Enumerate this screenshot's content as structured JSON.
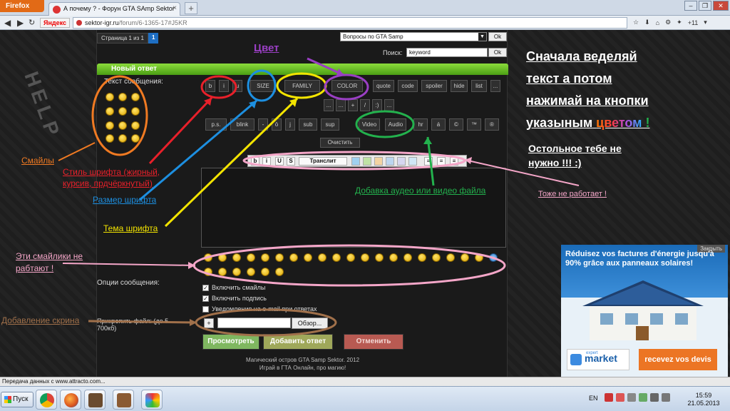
{
  "browser": {
    "app_button": "Firefox",
    "tab_title": "А почему ? - Форун GTA SAmp Sektor",
    "tab_close": "×",
    "new_tab": "+",
    "search_engine": "Яндекс",
    "url_domain": "sektor-igr.ru",
    "url_path": "/forum/6-1365-17#J5KR",
    "addon_count": "+11"
  },
  "forum": {
    "pager_label": "Страница 1 из 1",
    "pager_current": "1",
    "jump_select": "Вопросы по GTA Samp",
    "ok": "Ok",
    "search_label": "Поиск:",
    "search_value": "keyword",
    "panel_title": "Новый ответ",
    "message_label": "Текст сообщения:",
    "toolbar_row1": [
      "b",
      "i",
      "u",
      "SIZE",
      "FAMILY",
      "COLOR",
      "quote",
      "code",
      "spoiler",
      "hide",
      "list",
      "..."
    ],
    "toolbar_row2": [
      "...",
      "...",
      "+",
      "/",
      ":)",
      "..."
    ],
    "toolbar_row3": [
      "p.s.",
      "blink",
      "-",
      "ō",
      "j",
      "sub",
      "sup",
      "Video",
      "Audio",
      "hr",
      "á",
      "©",
      "™",
      "®"
    ],
    "clear_label": "Очистить",
    "editor2": [
      "b",
      "i",
      "U",
      "S",
      "Транслит"
    ],
    "options_label": "Опции сообщения:",
    "checkboxes": [
      {
        "label": "Включить смайлы",
        "checked": true
      },
      {
        "label": "Включить подпись",
        "checked": true
      },
      {
        "label": "Уведомления на e-mail при ответах",
        "checked": false
      }
    ],
    "attach_label": "Прикрепить файл: (до 5 — 700кб)",
    "add_btn": "+",
    "browse_btn": "Обзор...",
    "preview_btn": "Просмотреть",
    "submit_btn": "Добавить ответ",
    "cancel_btn": "Отменить",
    "footer_line1": "Магический остров GTA Samp Sektor. 2012",
    "footer_line2": "Играй в ГТА Онлайн, про магию!"
  },
  "annotations": {
    "cvet": "Цвет",
    "headline": [
      "Сначала веделяй",
      "текст а потом",
      "нажимай на кнопки"
    ],
    "headline_last": "указыным",
    "headline_color_word": "цветом",
    "headline_tail": "!",
    "note": [
      "Остольное тебе не",
      "нужно !!! :)"
    ],
    "smiles": "Смайлы",
    "font_style": [
      "Стиль шрифта (жирный,",
      "курсив, прдчёркнутый)"
    ],
    "font_size": "Размер шрифта",
    "audio_video": "Добавка аудео или видео файла",
    "also_broken": "Тоже не работает !",
    "font_theme": "Тема шрифта",
    "smiles_broken": [
      "Эти смайлики не",
      "рабтают !"
    ],
    "screenshot_add": "Добавление скрина"
  },
  "ad": {
    "close": "Закрыть",
    "title": "Réduisez vos factures d'énergie jusqu'à 90% grâce aux panneaux solaires!",
    "logo_small": "expert",
    "logo": "market",
    "cta": "recevez vos devis"
  },
  "status_text": "Передача данных с www.attracto.com...",
  "taskbar": {
    "start": "Пуск",
    "lang": "EN",
    "time": "15:59",
    "date": "21.05.2013"
  },
  "colors": {
    "orange": "#f07a22",
    "red": "#e8202a",
    "blue": "#1d8fe0",
    "yellow": "#f3e400",
    "purple": "#9a3fc4",
    "green": "#23b14d",
    "pink": "#f4a6c8",
    "brown": "#a0704a"
  }
}
